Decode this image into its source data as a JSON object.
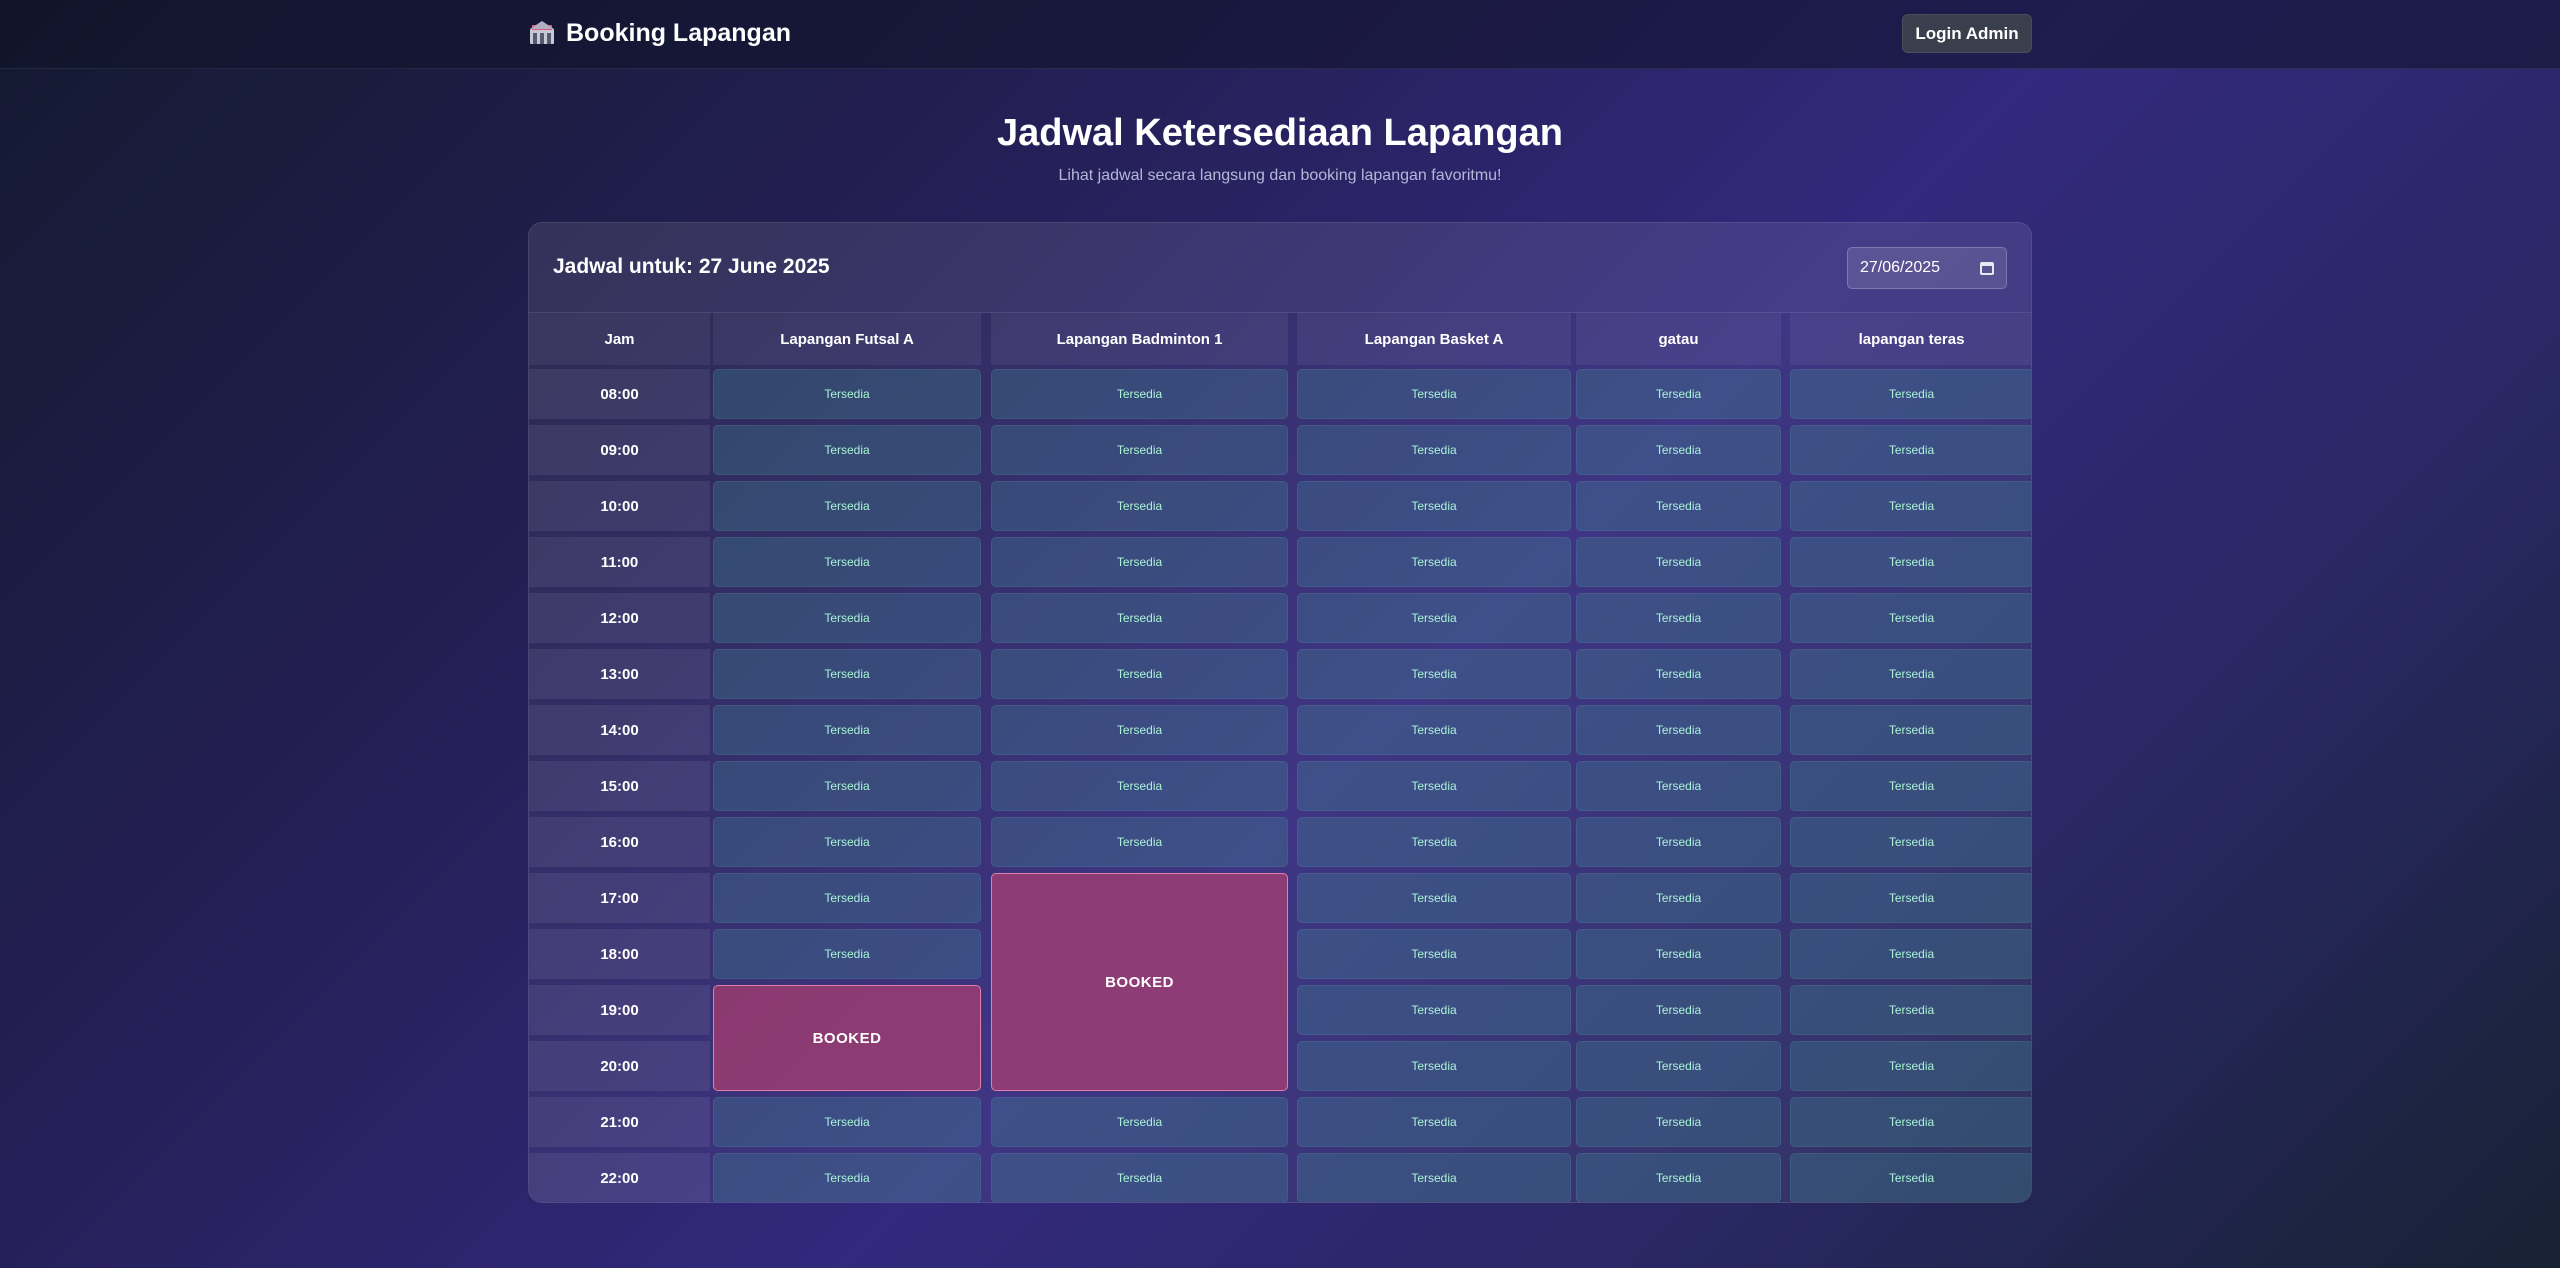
{
  "header": {
    "brand": "Booking Lapangan",
    "brand_icon": "stadium-icon",
    "login_label": "Login Admin"
  },
  "hero": {
    "title": "Jadwal Ketersediaan Lapangan",
    "subtitle": "Lihat jadwal secara langsung dan booking lapangan favoritmu!"
  },
  "schedule": {
    "heading": "Jadwal untuk: 27 June 2025",
    "date_value": "27/06/2025",
    "time_header": "Jam",
    "courts": [
      "Lapangan Futsal A",
      "Lapangan Badminton 1",
      "Lapangan Basket A",
      "gatau",
      "lapangan teras"
    ],
    "times": [
      "08:00",
      "09:00",
      "10:00",
      "11:00",
      "12:00",
      "13:00",
      "14:00",
      "15:00",
      "16:00",
      "17:00",
      "18:00",
      "19:00",
      "20:00",
      "21:00",
      "22:00"
    ],
    "available_label": "Tersedia",
    "booked_label": "BOOKED",
    "bookings": [
      {
        "court": "Lapangan Futsal A",
        "start": "19:00",
        "end": "20:00"
      },
      {
        "court": "Lapangan Badminton 1",
        "start": "17:00",
        "end": "20:00"
      }
    ]
  },
  "colors": {
    "available": "#3c7f8a",
    "booked": "#b8406c",
    "accent": "#33297d"
  }
}
